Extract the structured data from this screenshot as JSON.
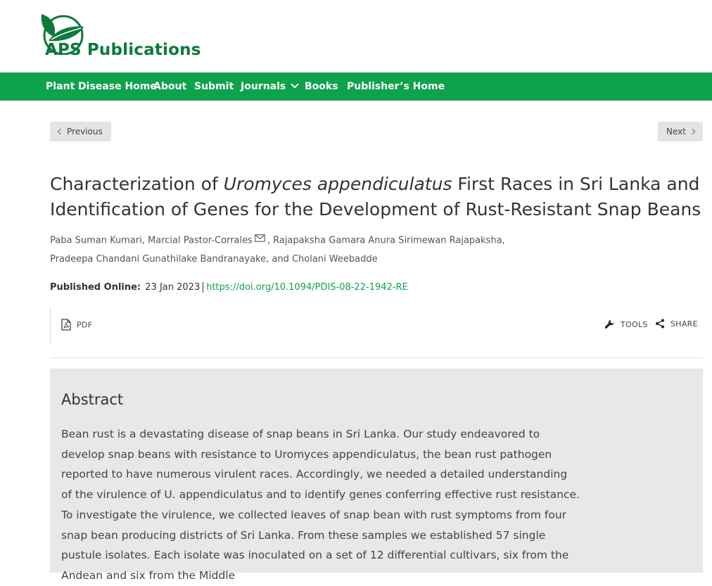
{
  "header": {
    "logo_aps": "APS",
    "logo_publications": "Publications",
    "brand_color": "#0b7a3b",
    "nav_color": "#0ea24d"
  },
  "nav": {
    "items": [
      {
        "label": "Plant Disease Home"
      },
      {
        "label": "About"
      },
      {
        "label": "Submit"
      },
      {
        "label": "Journals"
      },
      {
        "label": "Books"
      },
      {
        "label": "Publisher’s Home"
      }
    ]
  },
  "pager": {
    "previous": "Previous",
    "next": "Next"
  },
  "article": {
    "title_part1": "Characterization of ",
    "title_italic": "Uromyces appendiculatus",
    "title_part2": " First Races in Sri Lanka and Identification of Genes for the Development of Rust-Resistant Snap Beans",
    "authors_line1a": "Paba Suman Kumari, Marcial Pastor-Corrales",
    "authors_line1b": ", Rajapaksha Gamara Anura Sirimewan Rajapaksha,",
    "authors_line2": "Pradeepa Chandani Gunathilake Bandranayake, and Cholani Weebadde",
    "published_label": "Published Online:",
    "published_date": "23 Jan 2023",
    "doi": "https://doi.org/10.1094/PDIS-08-22-1942-RE"
  },
  "toolbar": {
    "pdf": "PDF",
    "tools": "TOOLS",
    "share": "SHARE"
  },
  "abstract": {
    "heading": "Abstract",
    "text": "Bean rust is a devastating disease of snap beans in Sri Lanka. Our study endeavored to develop snap beans with resistance to Uromyces appendiculatus, the bean rust pathogen reported to have numerous virulent races. Accordingly, we needed a detailed understanding of the virulence of U. appendiculatus and to identify genes conferring effective rust resistance. To investigate the virulence, we collected leaves of snap bean with rust symptoms from four snap bean producing districts of Sri Lanka. From these samples we established 57 single pustule isolates. Each isolate was inoculated on a set of 12 differential cultivars, six from the Andean and six from the Middle"
  }
}
